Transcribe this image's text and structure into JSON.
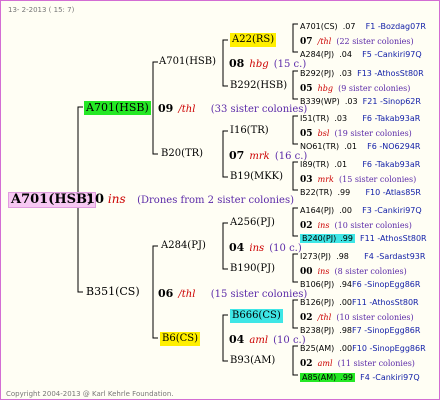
{
  "header_date": "13- 2-2013 ( 15: 7)",
  "copyright": "Copyright 2004-2013 @ Karl Kehrle Foundation.",
  "root": {
    "name": "A701(HSB)",
    "gen": "10",
    "ins": "ins",
    "sisters": "(Drones from 2 sister colonies)"
  },
  "l1": [
    {
      "name": "A701(HSB)",
      "gen": "09",
      "ins": "/thl",
      "sisters": "(33 sister colonies)"
    },
    {
      "name": "B351(CS)",
      "gen": "06",
      "ins": "/thl",
      "sisters": "(15 sister colonies)"
    }
  ],
  "l2": [
    {
      "name": "A701(HSB)",
      "gen": "08",
      "ins": "hbg",
      "sisters": "(15 c.)"
    },
    {
      "name": "B20(TR)",
      "gen": "07",
      "ins": "mrk",
      "sisters": "(16 c.)"
    },
    {
      "name": "A284(PJ)",
      "gen": "04",
      "ins": "ins",
      "sisters": "(10 c.)"
    },
    {
      "name": "B6(CS)",
      "gen": "04",
      "ins": "aml",
      "sisters": "(10 c.)"
    }
  ],
  "l3": [
    {
      "name": "A22(RS)",
      "gen": "07",
      "ins": "/thl",
      "sisters": "(22 sister colonies)"
    },
    {
      "name": "B292(HSB)",
      "gen": "05",
      "ins": "hbg",
      "sisters": "(9 sister colonies)"
    },
    {
      "name": "I16(TR)",
      "gen": "05",
      "ins": "bsl",
      "sisters": "(19 sister colonies)"
    },
    {
      "name": "B19(MKK)",
      "gen": "03",
      "ins": "mrk",
      "sisters": "(15 sister colonies)"
    },
    {
      "name": "A256(PJ)",
      "gen": "02",
      "ins": "ins",
      "sisters": "(10 sister colonies)"
    },
    {
      "name": "B190(PJ)",
      "gen": "00",
      "ins": "ins",
      "sisters": "(8 sister colonies)"
    },
    {
      "name": "B666(CS)",
      "gen": "02",
      "ins": "/thl",
      "sisters": "(10 sister colonies)"
    },
    {
      "name": "B93(AM)",
      "gen": "02",
      "ins": "aml",
      "sisters": "(11 sister colonies)"
    }
  ],
  "l4": [
    {
      "name": "A701(CS)",
      "gen": ".07",
      "f": "F1 -Bozdag07R"
    },
    {
      "name": "A284(PJ)",
      "gen": ".04",
      "f": "F5 -Cankiri97Q"
    },
    {
      "name": "B292(PJ)",
      "gen": ".03",
      "f": "F13 -AthosSt80R"
    },
    {
      "name": "B339(WP)",
      "gen": ".03",
      "f": "F21 -Sinop62R"
    },
    {
      "name": "I51(TR)",
      "gen": ".03",
      "f": "F6 -Takab93aR"
    },
    {
      "name": "NO61(TR)",
      "gen": ".01",
      "f": "F6 -NO6294R"
    },
    {
      "name": "I89(TR)",
      "gen": ".01",
      "f": "F6 -Takab93aR"
    },
    {
      "name": "B22(TR)",
      "gen": ".99",
      "f": "F10 -Atlas85R"
    },
    {
      "name": "A164(PJ)",
      "gen": ".00",
      "f": "F3 -Cankiri97Q"
    },
    {
      "name": "B240(PJ)",
      "gen": ".99",
      "f": "F11 -AthosSt80R"
    },
    {
      "name": "I273(PJ)",
      "gen": ".98",
      "f": "F4 -Sardast93R"
    },
    {
      "name": "B106(PJ)",
      "gen": ".94",
      "f": "F6 -SinopEgg86R"
    },
    {
      "name": "B126(PJ)",
      "gen": ".00",
      "f": "F11 -AthosSt80R"
    },
    {
      "name": "B238(PJ)",
      "gen": ".98",
      "f": "F7 -SinopEgg86R"
    },
    {
      "name": "B25(AM)",
      "gen": ".00",
      "f": "F10 -SinopEgg86R"
    },
    {
      "name": "A85(AM)",
      "gen": ".99",
      "f": "F4 -Cankiri97Q"
    }
  ]
}
